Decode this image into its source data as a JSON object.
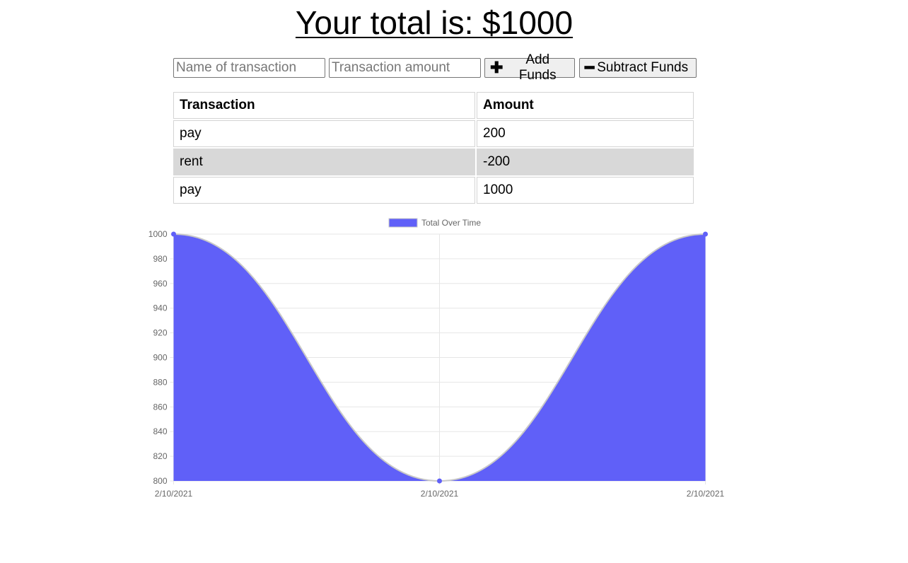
{
  "header": {
    "total_text": "Your total is: $1000"
  },
  "form": {
    "name_placeholder": "Name of transaction",
    "amount_placeholder": "Transaction amount",
    "add_label": "Add Funds",
    "subtract_label": "Subtract Funds",
    "add_icon": "plus-icon",
    "subtract_icon": "minus-icon"
  },
  "table": {
    "headers": [
      "Transaction",
      "Amount"
    ],
    "rows": [
      {
        "name": "pay",
        "amount": "200"
      },
      {
        "name": "rent",
        "amount": "-200"
      },
      {
        "name": "pay",
        "amount": "1000"
      }
    ]
  },
  "colors": {
    "series_fill": "#6060f8",
    "series_line": "#c8c8c8",
    "grid": "#e6e6e6",
    "alt_row": "#d8d8d8"
  },
  "chart_data": {
    "type": "area",
    "x": [
      "2/10/2021",
      "2/10/2021",
      "2/10/2021"
    ],
    "series": [
      {
        "name": "Total Over Time",
        "values": [
          1000,
          800,
          1000
        ]
      }
    ],
    "ylim": [
      800,
      1000
    ],
    "yticks": [
      800,
      820,
      840,
      860,
      880,
      900,
      920,
      940,
      960,
      980,
      1000
    ],
    "title": "",
    "xlabel": "",
    "ylabel": "",
    "legend": "top",
    "grid": true,
    "smooth": true
  }
}
